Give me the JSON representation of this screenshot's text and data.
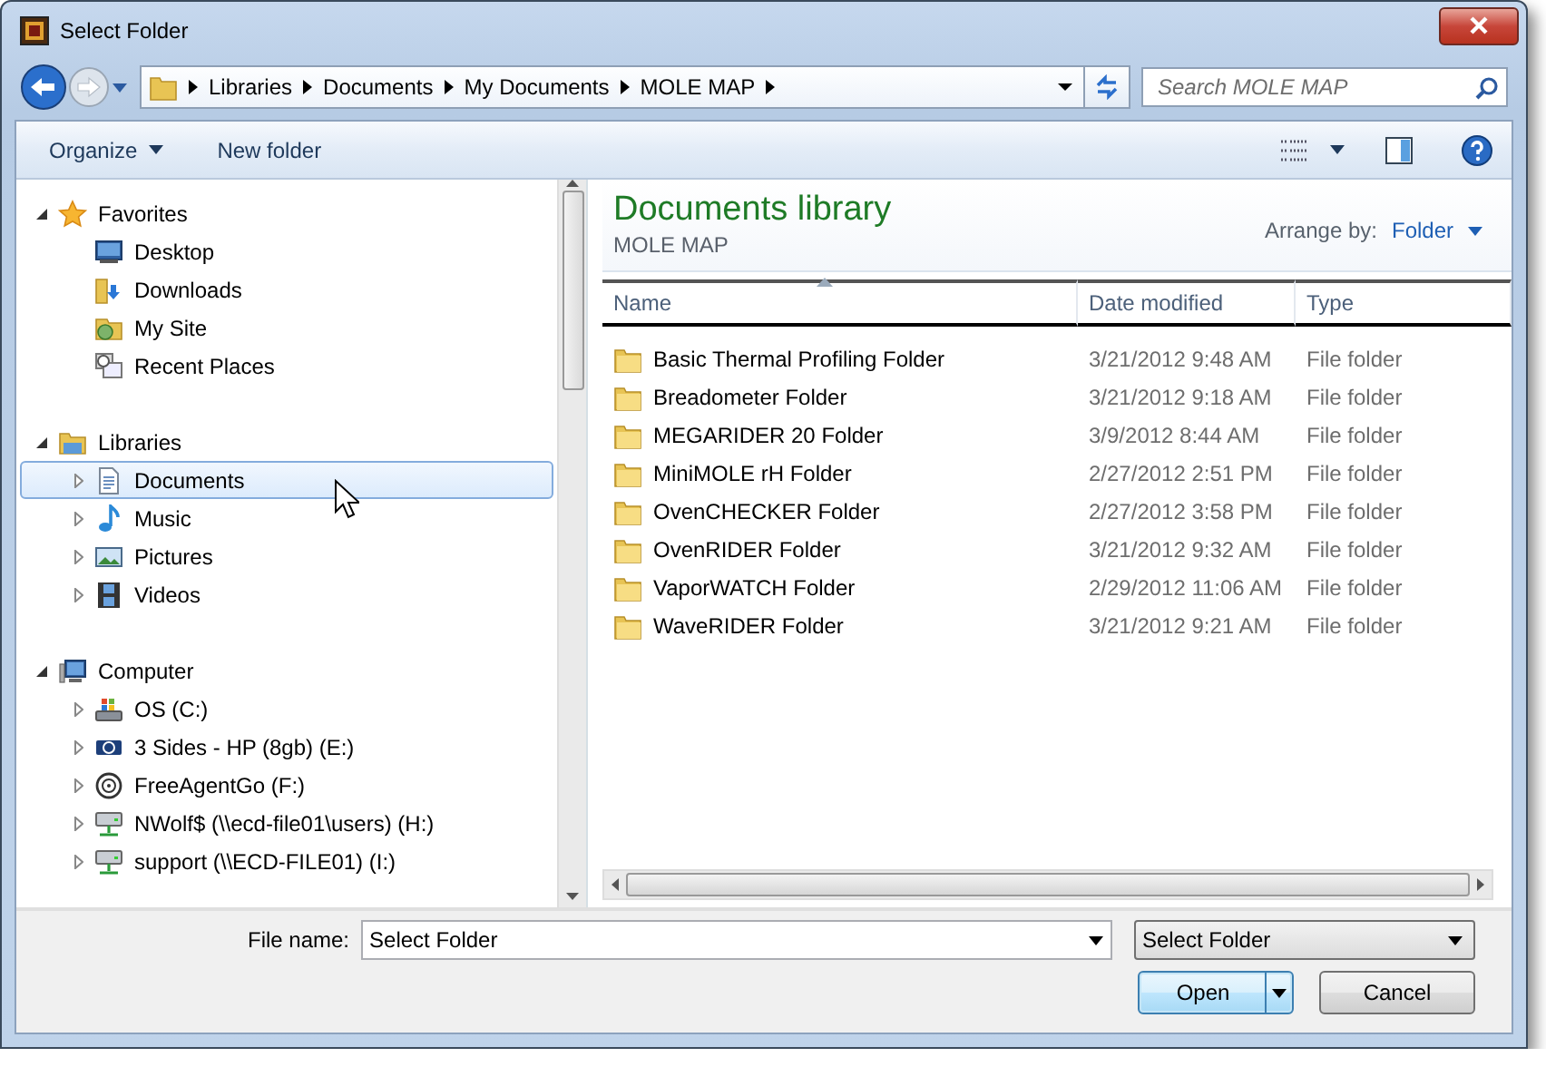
{
  "window": {
    "title": "Select Folder"
  },
  "address": {
    "segments": [
      "Libraries",
      "Documents",
      "My Documents",
      "MOLE MAP"
    ]
  },
  "search": {
    "placeholder": "Search MOLE MAP"
  },
  "toolbar": {
    "organize": "Organize",
    "new_folder": "New folder"
  },
  "tree": [
    {
      "label": "Favorites",
      "kind": "favorites",
      "expanded": true,
      "selected": false,
      "children": [
        {
          "label": "Desktop",
          "kind": "desktop",
          "selected": false
        },
        {
          "label": "Downloads",
          "kind": "downloads",
          "selected": false
        },
        {
          "label": "My Site",
          "kind": "site",
          "selected": false
        },
        {
          "label": "Recent Places",
          "kind": "recent",
          "selected": false
        }
      ]
    },
    {
      "label": "Libraries",
      "kind": "libraries",
      "expanded": true,
      "selected": false,
      "children": [
        {
          "label": "Documents",
          "kind": "documents",
          "expanded": false,
          "selected": true
        },
        {
          "label": "Music",
          "kind": "music",
          "expanded": false,
          "selected": false
        },
        {
          "label": "Pictures",
          "kind": "pictures",
          "expanded": false,
          "selected": false
        },
        {
          "label": "Videos",
          "kind": "videos",
          "expanded": false,
          "selected": false
        }
      ]
    },
    {
      "label": "Computer",
      "kind": "computer",
      "expanded": true,
      "selected": false,
      "children": [
        {
          "label": "OS (C:)",
          "kind": "system-drive",
          "expanded": false,
          "selected": false
        },
        {
          "label": "3 Sides - HP (8gb) (E:)",
          "kind": "usb-drive",
          "expanded": false,
          "selected": false
        },
        {
          "label": "FreeAgentGo (F:)",
          "kind": "external-drive",
          "expanded": false,
          "selected": false
        },
        {
          "label": "NWolf$ (\\\\ecd-file01\\users) (H:)",
          "kind": "network-drive",
          "expanded": false,
          "selected": false
        },
        {
          "label": "support (\\\\ECD-FILE01) (I:)",
          "kind": "network-drive",
          "expanded": false,
          "selected": false
        }
      ]
    }
  ],
  "library": {
    "title": "Documents library",
    "subtitle": "MOLE MAP",
    "arrange_label": "Arrange by:",
    "arrange_value": "Folder"
  },
  "table": {
    "columns": [
      {
        "label": "Name",
        "sorted": true
      },
      {
        "label": "Date modified",
        "sorted": false
      },
      {
        "label": "Type",
        "sorted": false
      }
    ],
    "rows": [
      {
        "name": "Basic Thermal Profiling Folder",
        "date": "3/21/2012 9:48 AM",
        "type": "File folder"
      },
      {
        "name": "Breadometer Folder",
        "date": "3/21/2012 9:18 AM",
        "type": "File folder"
      },
      {
        "name": "MEGARIDER 20 Folder",
        "date": "3/9/2012 8:44 AM",
        "type": "File folder"
      },
      {
        "name": "MiniMOLE rH Folder",
        "date": "2/27/2012 2:51 PM",
        "type": "File folder"
      },
      {
        "name": "OvenCHECKER Folder",
        "date": "2/27/2012 3:58 PM",
        "type": "File folder"
      },
      {
        "name": "OvenRIDER Folder",
        "date": "3/21/2012 9:32 AM",
        "type": "File folder"
      },
      {
        "name": "VaporWATCH Folder",
        "date": "2/29/2012 11:06 AM",
        "type": "File folder"
      },
      {
        "name": "WaveRIDER Folder",
        "date": "3/21/2012 9:21 AM",
        "type": "File folder"
      }
    ]
  },
  "footer": {
    "file_name_label": "File name:",
    "file_name_value": "Select Folder",
    "filter": "Select Folder",
    "buttons": [
      {
        "label": "Open",
        "default": true
      },
      {
        "label": "Cancel",
        "default": false
      }
    ]
  }
}
